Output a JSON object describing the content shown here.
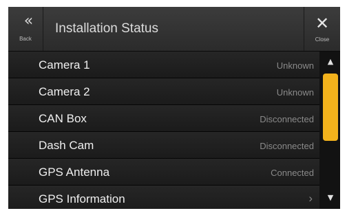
{
  "header": {
    "title": "Installation Status",
    "back_label": "Back",
    "close_label": "Close",
    "back_icon": "«",
    "close_icon": "✕"
  },
  "items": [
    {
      "label": "Camera 1",
      "status": "Unknown"
    },
    {
      "label": "Camera 2",
      "status": "Unknown"
    },
    {
      "label": "CAN Box",
      "status": "Disconnected"
    },
    {
      "label": "Dash Cam",
      "status": "Disconnected"
    },
    {
      "label": "GPS Antenna",
      "status": "Connected"
    },
    {
      "label": "GPS Information",
      "chevron": "›"
    }
  ],
  "scrollbar": {
    "up_icon": "▲",
    "down_icon": "▼",
    "thumb_color": "#f2b21c"
  }
}
